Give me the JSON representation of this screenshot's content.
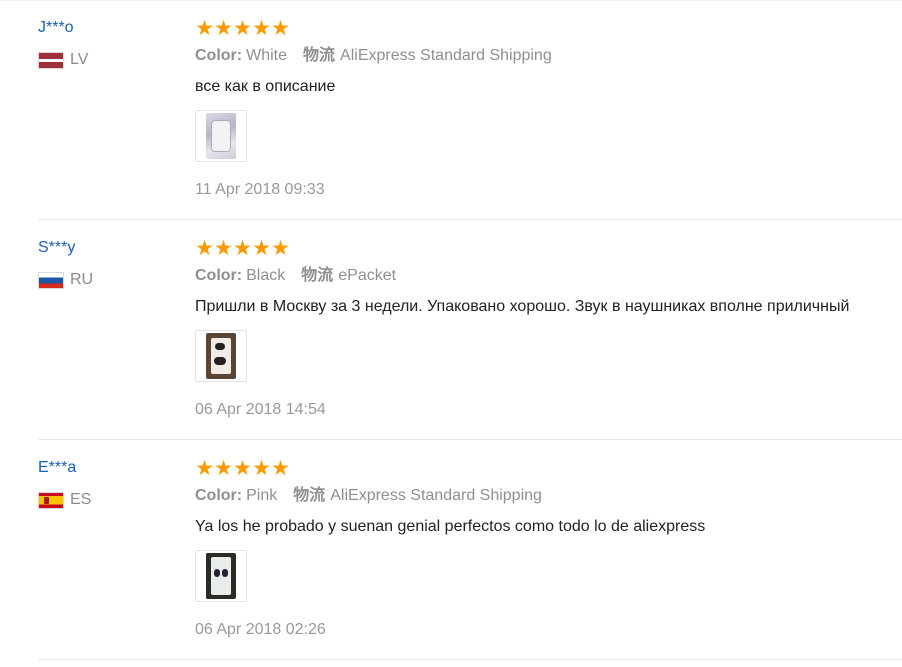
{
  "rating_star": "★",
  "reviews": [
    {
      "user": "J***o",
      "country_code": "LV",
      "flag": "lv-flag-icon",
      "color_label": "Color:",
      "color_value": "White",
      "shipping_label": "物流",
      "shipping_value": "AliExpress Standard Shipping",
      "text": "все как в описание",
      "date": "11 Apr 2018 09:33",
      "stars": 5
    },
    {
      "user": "S***y",
      "country_code": "RU",
      "flag": "ru-flag-icon",
      "color_label": "Color:",
      "color_value": "Black",
      "shipping_label": "物流",
      "shipping_value": "ePacket",
      "text": "Пришли в Москву за 3 недели. Упаковано хорошо. Звук в наушниках вполне приличный",
      "date": "06 Apr 2018 14:54",
      "stars": 5
    },
    {
      "user": "E***a",
      "country_code": "ES",
      "flag": "es-flag-icon",
      "color_label": "Color:",
      "color_value": "Pink",
      "shipping_label": "物流",
      "shipping_value": "AliExpress Standard Shipping",
      "text": "Ya los he probado y suenan genial perfectos como todo lo de aliexpress",
      "date": "06 Apr 2018 02:26",
      "stars": 5
    }
  ],
  "colors": {
    "star": "#ff9900",
    "username": "#1a5fb4",
    "muted": "#999999"
  }
}
